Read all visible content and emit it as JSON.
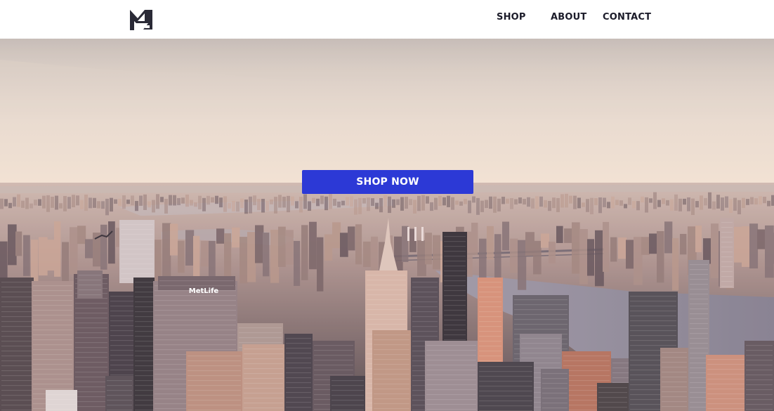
{
  "header": {
    "logo_icon": "monogram-logo-icon",
    "nav": [
      {
        "label": "SHOP"
      },
      {
        "label": "ABOUT"
      },
      {
        "label": "CONTACT"
      }
    ]
  },
  "hero": {
    "background": "aerial-city-skyline-photo",
    "cta_label": "SHOP NOW",
    "building_sign": "MetLife"
  },
  "colors": {
    "cta_bg": "#2c39d6",
    "nav_text": "#1c1c2a",
    "sky_top": "#cfc6c0",
    "sky_glow": "#f4e4d6"
  }
}
